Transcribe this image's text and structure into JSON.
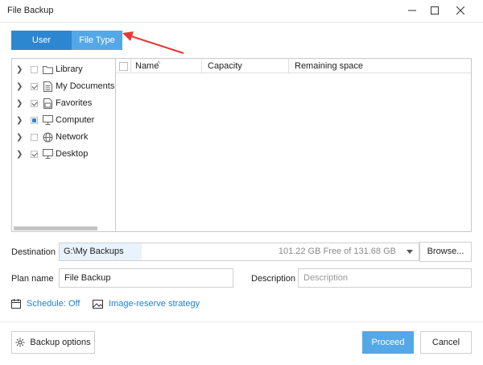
{
  "window": {
    "title": "File Backup"
  },
  "tabs": [
    {
      "label": "User Defined",
      "active": true
    },
    {
      "label": "File Type",
      "active": false
    }
  ],
  "tree": {
    "items": [
      {
        "label": "Library",
        "checked": "none",
        "icon": "folder-icon"
      },
      {
        "label": "My Documents",
        "checked": "checked",
        "icon": "document-icon"
      },
      {
        "label": "Favorites",
        "checked": "checked",
        "icon": "favorites-icon"
      },
      {
        "label": "Computer",
        "checked": "partial",
        "icon": "computer-icon"
      },
      {
        "label": "Network",
        "checked": "none",
        "icon": "network-icon"
      },
      {
        "label": "Desktop",
        "checked": "checked",
        "icon": "desktop-icon"
      }
    ]
  },
  "table": {
    "columns": [
      "Name",
      "Capacity",
      "Remaining space"
    ],
    "rows": []
  },
  "destination": {
    "label": "Destination",
    "path": "G:\\My Backups",
    "free_text": "101.22 GB Free of 131.68 GB",
    "browse_label": "Browse..."
  },
  "plan": {
    "label": "Plan name",
    "value": "File Backup"
  },
  "description": {
    "label": "Description",
    "placeholder": "Description"
  },
  "links": {
    "schedule": "Schedule: Off",
    "image_reserve": "Image-reserve strategy"
  },
  "footer": {
    "backup_options": "Backup options",
    "proceed": "Proceed",
    "cancel": "Cancel"
  },
  "colors": {
    "accent": "#2d86d0",
    "accent_light": "#55a8e8",
    "link": "#1f7fcf",
    "arrow": "#e53935"
  }
}
